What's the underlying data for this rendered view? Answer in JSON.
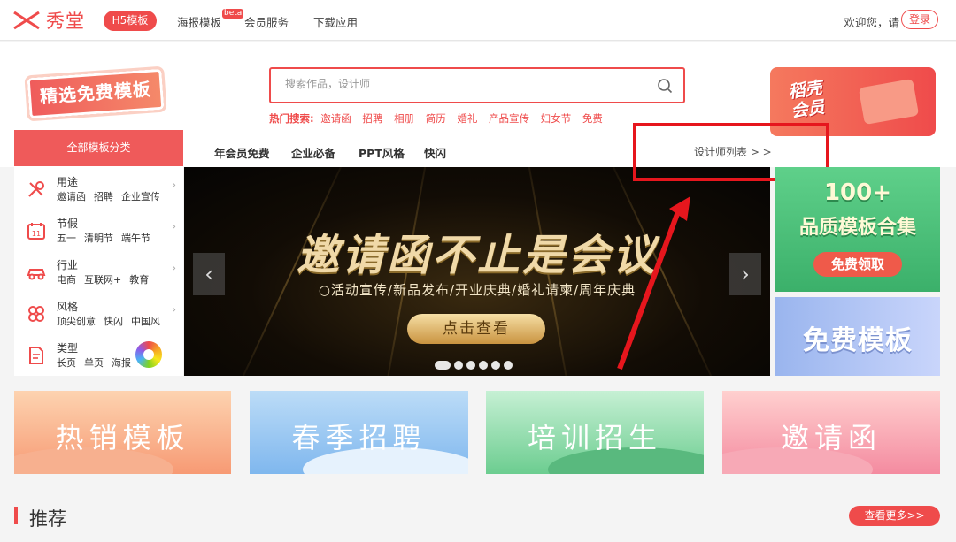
{
  "nav": {
    "brand": "秀堂",
    "h5": "H5模板",
    "poster": "海报模板",
    "beta": "beta",
    "member": "会员服务",
    "download": "下载应用",
    "welcome": "欢迎您，请",
    "login": "登录"
  },
  "promo_badge": "精选免费模板",
  "search": {
    "placeholder": "搜索作品，设计师",
    "hot_label": "热门搜索:",
    "hot_keywords": [
      "邀请函",
      "招聘",
      "相册",
      "简历",
      "婚礼",
      "产品宣传",
      "妇女节",
      "免费"
    ]
  },
  "vip_banner": {
    "text": "稻壳会员"
  },
  "categories": {
    "all_label": "全部模板分类",
    "tabs": [
      "年会员免费",
      "企业必备",
      "PPT风格",
      "快闪"
    ],
    "designer_link": "设计师列表 > >",
    "items": [
      {
        "title": "用途",
        "subs": [
          "邀请函",
          "招聘",
          "企业宣传"
        ],
        "icon": "tools-icon"
      },
      {
        "title": "节假",
        "subs": [
          "五一",
          "清明节",
          "端午节"
        ],
        "icon": "calendar-icon"
      },
      {
        "title": "行业",
        "subs": [
          "电商",
          "互联网+",
          "教育"
        ],
        "icon": "car-icon"
      },
      {
        "title": "风格",
        "subs": [
          "顶尖创意",
          "快闪",
          "中国风"
        ],
        "icon": "flower-icon"
      },
      {
        "title": "类型",
        "subs": [
          "长页",
          "单页",
          "海报"
        ],
        "icon": "document-icon"
      }
    ]
  },
  "hero": {
    "title": "邀请函不止是会议",
    "subtitle": "○活动宣传/新品发布/开业庆典/婚礼请柬/周年庆典",
    "button": "点击查看",
    "slide_count": 6,
    "active_slide": 1
  },
  "side_tiles": {
    "green_line1": "100+",
    "green_line2": "品质模板合集",
    "green_button": "免费领取",
    "blue": "免费模板"
  },
  "features": [
    "热销模板",
    "春季招聘",
    "培训招生",
    "邀请函"
  ],
  "recommend": {
    "title": "推荐",
    "more": "查看更多>>"
  },
  "colors": {
    "brand": "#ef4b4b",
    "annotation": "#e6161d"
  }
}
